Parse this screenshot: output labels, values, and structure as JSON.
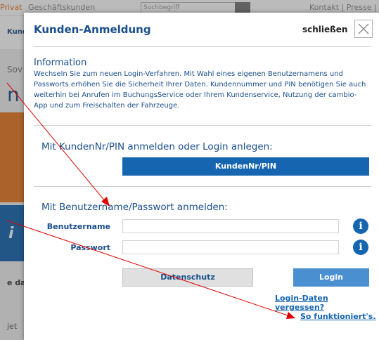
{
  "background": {
    "top_left_text": "Privat",
    "top_mid_text": "Geschäftskunden",
    "search_placeholder": "Suchbegriff",
    "top_right_text": "Kontakt | Presse | ...",
    "nav_text": "Kund",
    "so_text": "Sov",
    "n_text": "n",
    "blue_text": "i",
    "eda_text": "e da",
    "jet_text": "jet"
  },
  "modal": {
    "title": "Kunden-Anmeldung",
    "close_label": "schließen",
    "close_icon": "close-icon",
    "info": {
      "title": "Information",
      "text": "Wechseln Sie zum neuen Login-Verfahren. Mit Wahl eines eigenen Benutzernamens und Passworts erhöhen Sie die Sicherheit Ihrer Daten. Kundennummer und PIN benötigen Sie auch weiterhin bei Anrufen im BuchungsService oder Ihrem Kundenservice, Nutzung der cambio-App und zum Freischalten der Fahrzeuge."
    },
    "pin_section": {
      "heading": "Mit KundenNr/PIN anmelden oder Login anlegen:",
      "button_label": "KundenNr/PIN"
    },
    "login_section": {
      "heading": "Mit Benutzername/Passwort anmelden:",
      "username_label": "Benutzername",
      "username_value": "",
      "password_label": "Passwort",
      "password_value": "",
      "info_icon_glyph": "i",
      "privacy_button": "Datenschutz",
      "login_button": "Login",
      "forgot_link": "Login-Daten vergessen?",
      "howto_link": "So funktioniert's."
    },
    "colors": {
      "brand_blue": "#1565b0",
      "heading_blue": "#1a4f8c",
      "login_button": "#4a90d0",
      "annotation_arrow": "#e00000"
    }
  }
}
